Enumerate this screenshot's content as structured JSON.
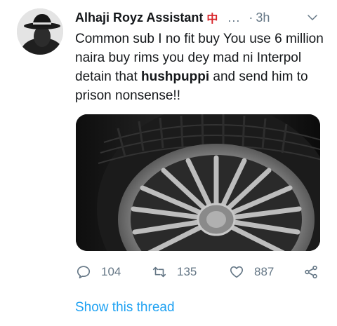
{
  "tweet": {
    "display_name": "Alhaji Royz Assistant",
    "name_emoji": "中",
    "handle_truncated": "...",
    "separator": "·",
    "time": "3h",
    "text_before": "Common sub I no fit buy You use 6 million naira buy rims you dey mad ni Interpol detain that ",
    "text_bold": "hushpuppi",
    "text_after": " and send him to prison nonsense!!"
  },
  "actions": {
    "reply_count": "104",
    "retweet_count": "135",
    "like_count": "887"
  },
  "footer": {
    "show_thread_label": "Show this thread"
  },
  "colors": {
    "link_blue": "#1da1f2",
    "muted_gray": "#657786"
  },
  "icons": [
    "avatar-image",
    "chevron-down-icon",
    "reply-icon",
    "retweet-icon",
    "like-icon",
    "share-icon"
  ]
}
